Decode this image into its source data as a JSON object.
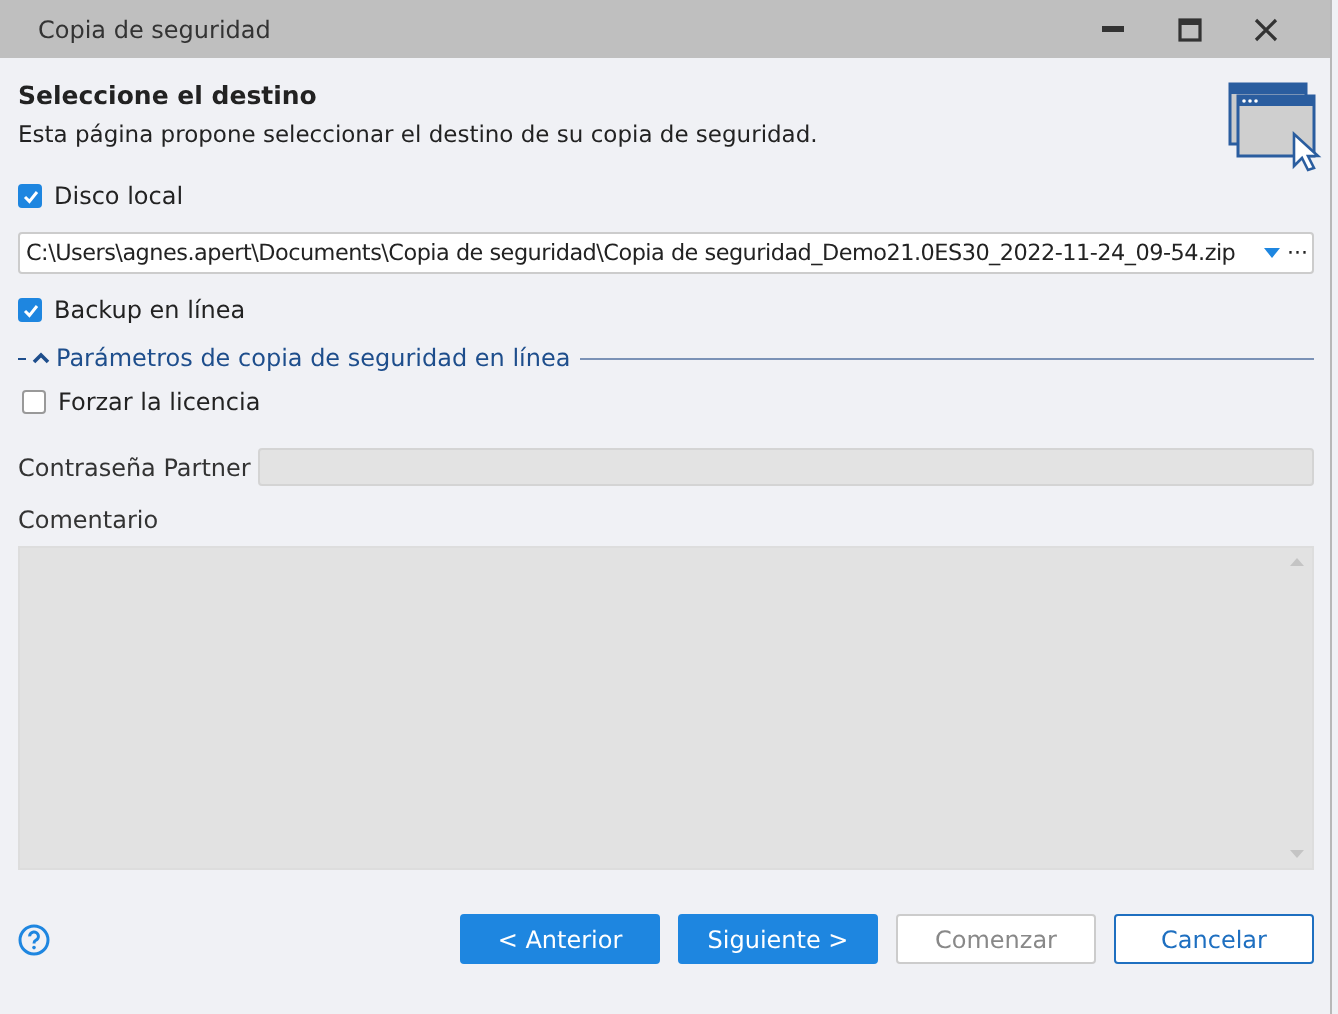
{
  "window": {
    "title": "Copia de seguridad"
  },
  "header": {
    "title": "Seleccione el destino",
    "subtitle": "Esta página propone seleccionar el destino de su copia de seguridad."
  },
  "local_disk": {
    "label": "Disco local",
    "checked": true
  },
  "path_field": {
    "value": "C:\\Users\\agnes.apert\\Documents\\Copia de seguridad\\Copia de seguridad_Demo21.0ES30_2022-11-24_09-54.zip",
    "browse": "···"
  },
  "online_backup": {
    "label": "Backup en línea",
    "checked": true
  },
  "online_section": {
    "title": "Parámetros de copia de seguridad en línea",
    "expanded": true
  },
  "force_license": {
    "label": "Forzar la licencia",
    "checked": false
  },
  "partner_password": {
    "label": "Contraseña Partner",
    "disabled": true
  },
  "comment": {
    "label": "Comentario",
    "disabled": true
  },
  "buttons": [
    {
      "label": "< Anterior",
      "kind": "primary"
    },
    {
      "label": "Siguiente >",
      "kind": "primary"
    },
    {
      "label": "Comenzar",
      "kind": "disabled"
    },
    {
      "label": "Cancelar",
      "kind": "default"
    }
  ]
}
